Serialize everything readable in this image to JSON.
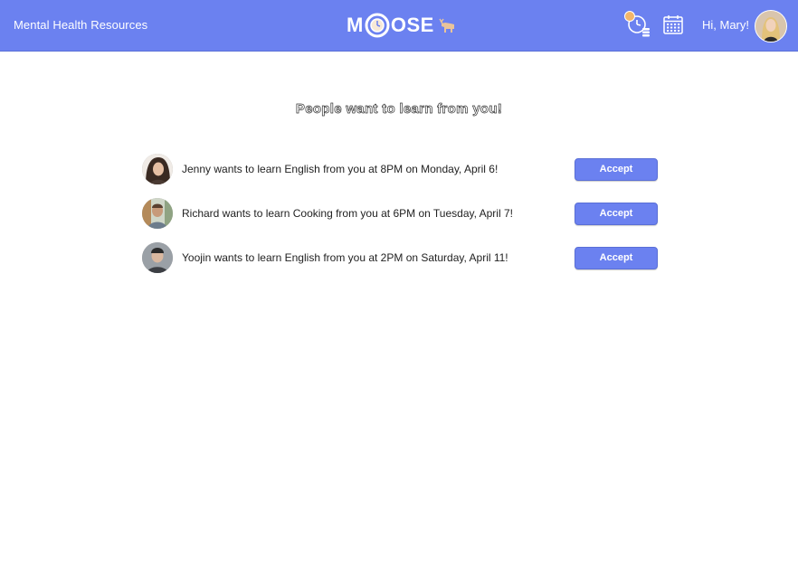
{
  "header": {
    "nav_link": "Mental Health Resources",
    "logo_text_left": "M",
    "logo_text_right": "OSE",
    "greeting": "Hi, Mary!",
    "accent_color": "#6b81f0"
  },
  "icons": {
    "schedule": "clock-stack-icon",
    "calendar": "calendar-icon",
    "logo_animal": "moose-icon"
  },
  "main": {
    "title": "People want to learn from you!",
    "requests": [
      {
        "text": "Jenny wants to learn English from you at 8PM on Monday, April 6!",
        "button": "Accept"
      },
      {
        "text": "Richard wants to learn Cooking from you at 6PM on Tuesday, April 7!",
        "button": "Accept"
      },
      {
        "text": "Yoojin wants to learn English from you at 2PM on Saturday, April 11!",
        "button": "Accept"
      }
    ]
  }
}
